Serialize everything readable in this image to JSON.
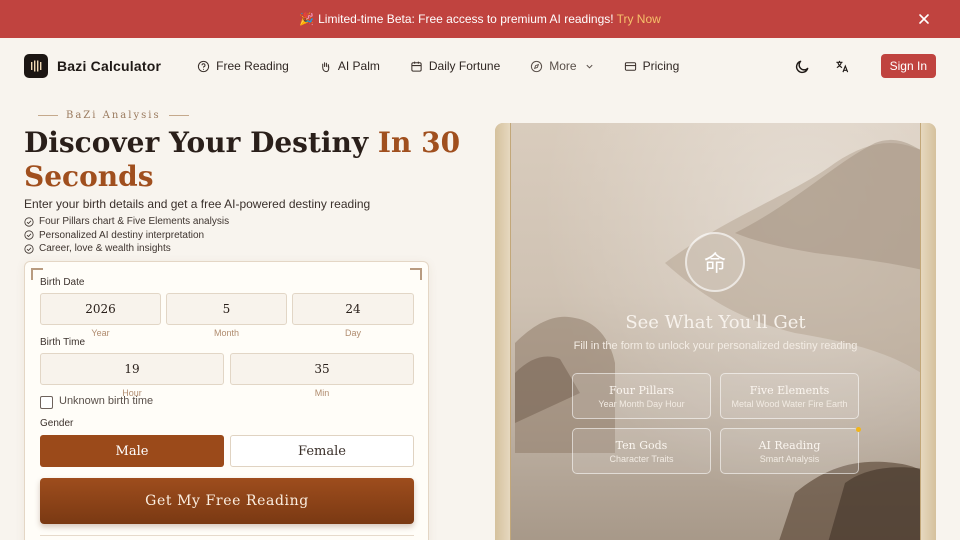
{
  "banner": {
    "emoji": "🎉",
    "text": "Limited-time Beta: Free access to premium AI readings!",
    "link": "Try Now"
  },
  "nav": {
    "brand": "Bazi Calculator",
    "items": [
      {
        "label": "Free Reading",
        "icon": "help-circle-icon"
      },
      {
        "label": "AI Palm",
        "icon": "hand-icon"
      },
      {
        "label": "Daily Fortune",
        "icon": "calendar-icon"
      },
      {
        "label": "More",
        "icon": "compass-icon"
      },
      {
        "label": "Pricing",
        "icon": "credit-card-icon"
      }
    ],
    "sign_in": "Sign In"
  },
  "hero": {
    "kicker": "BaZi Analysis",
    "headline_main": "Discover Your Destiny ",
    "headline_accent": "In 30 Seconds",
    "subtitle": "Enter your birth details and get a free AI-powered destiny reading",
    "features": [
      "Four Pillars chart & Five Elements analysis",
      "Personalized AI destiny interpretation",
      "Career, love & wealth insights"
    ]
  },
  "form": {
    "birth_date_label": "Birth Date",
    "year": "2026",
    "year_hint": "Year",
    "month": "5",
    "month_hint": "Month",
    "day": "24",
    "day_hint": "Day",
    "birth_time_label": "Birth Time",
    "hour": "19",
    "hour_hint": "Hour",
    "minute": "35",
    "minute_hint": "Min",
    "unknown_time": "Unknown birth time",
    "gender_label": "Gender",
    "male": "Male",
    "female": "Female",
    "submit": "Get My Free Reading"
  },
  "preview": {
    "seal_char": "命",
    "title": "See What You'll Get",
    "subtitle": "Fill in the form to unlock your personalized destiny reading",
    "tiles": [
      {
        "title": "Four Pillars",
        "sub": "Year Month Day Hour"
      },
      {
        "title": "Five Elements",
        "sub": "Metal Wood Water Fire Earth"
      },
      {
        "title": "Ten Gods",
        "sub": "Character Traits"
      },
      {
        "title": "AI Reading",
        "sub": "Smart Analysis"
      }
    ]
  },
  "colors": {
    "banner": "#c0433f",
    "accent": "#a04f1e",
    "button": "#9b4a1a"
  }
}
